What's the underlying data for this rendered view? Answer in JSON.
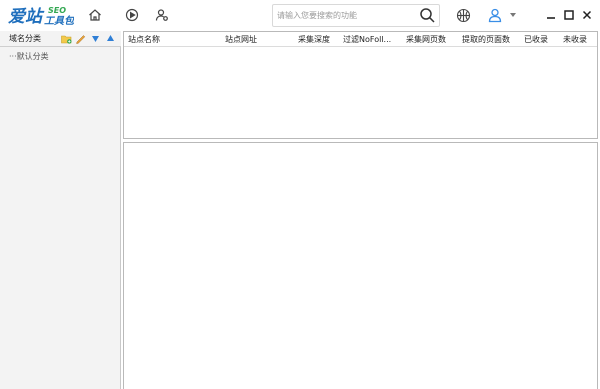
{
  "app": {
    "logo_text": "爱站",
    "logo_suffix": "SEO",
    "logo_sub": "工具包"
  },
  "toolbar": {
    "icons": [
      "home-icon",
      "play-icon",
      "user-settings-icon",
      "search-icon",
      "basketball-icon",
      "user-icon",
      "dropdown-arrow-icon"
    ],
    "search_placeholder": "请输入您要搜索的功能",
    "window_controls": [
      "minimize",
      "maximize",
      "close"
    ]
  },
  "left_panel": {
    "title": "域名分类",
    "actions": [
      "add-folder-icon",
      "edit-icon",
      "move-down-icon",
      "move-up-icon"
    ],
    "tree": [
      {
        "label": "···默认分类"
      }
    ]
  },
  "table": {
    "columns": [
      "站点名称",
      "站点网址",
      "采集深度",
      "过滤NoFoll...",
      "采集网页数",
      "提取的页面数",
      "已收录",
      "未收录"
    ],
    "rows": []
  },
  "colors": {
    "logo_blue": "#1f6fbd",
    "logo_green": "#34a853",
    "panel_bg": "#f3f3f3",
    "border": "#b9b9b9",
    "user_icon_blue": "#3a8ee6"
  }
}
